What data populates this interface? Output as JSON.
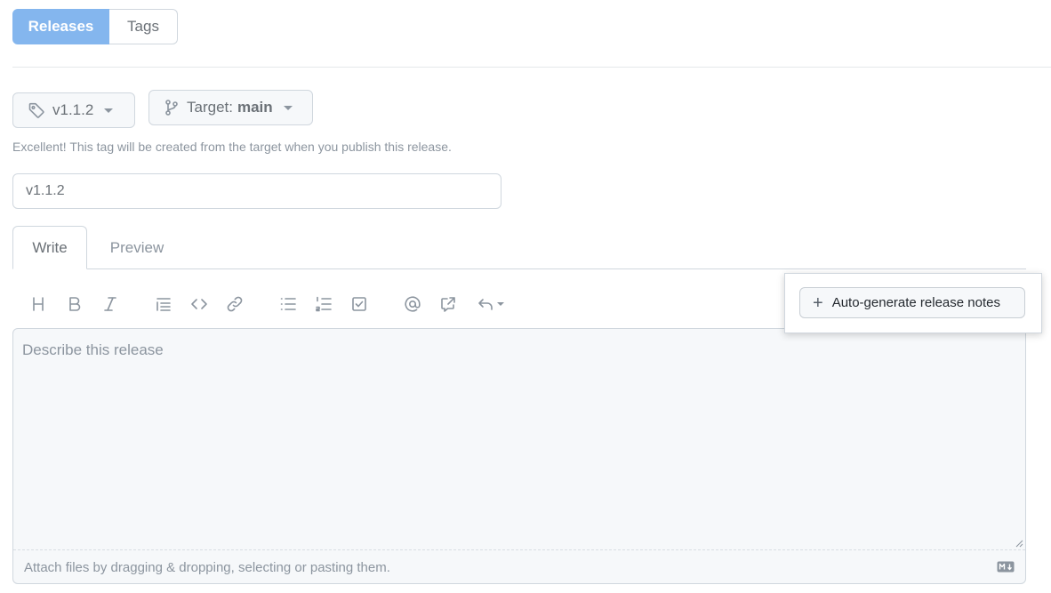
{
  "subnav": {
    "releases_label": "Releases",
    "tags_label": "Tags"
  },
  "tag_select": {
    "label": "v1.1.2",
    "icon": "tag-icon"
  },
  "target_select": {
    "prefix": "Target:",
    "branch": "main",
    "icon": "git-branch-icon"
  },
  "hint": "Excellent! This tag will be created from the target when you publish this release.",
  "release_title": {
    "value": "v1.1.2"
  },
  "tabs": {
    "write": "Write",
    "preview": "Preview"
  },
  "toolbar": {
    "icons": [
      "heading-icon",
      "bold-icon",
      "italic-icon",
      "quote-icon",
      "code-icon",
      "link-icon",
      "bulleted-list-icon",
      "numbered-list-icon",
      "task-list-icon",
      "mention-icon",
      "cross-reference-icon",
      "reply-icon"
    ]
  },
  "auto_generate": {
    "label": "Auto-generate release notes"
  },
  "editor": {
    "placeholder": "Describe this release",
    "attach_text": "Attach files by dragging & dropping, selecting or pasting them."
  },
  "colors": {
    "primary_active": "#84b6ee",
    "border": "#d0d7de",
    "muted_text": "#8c959f"
  }
}
